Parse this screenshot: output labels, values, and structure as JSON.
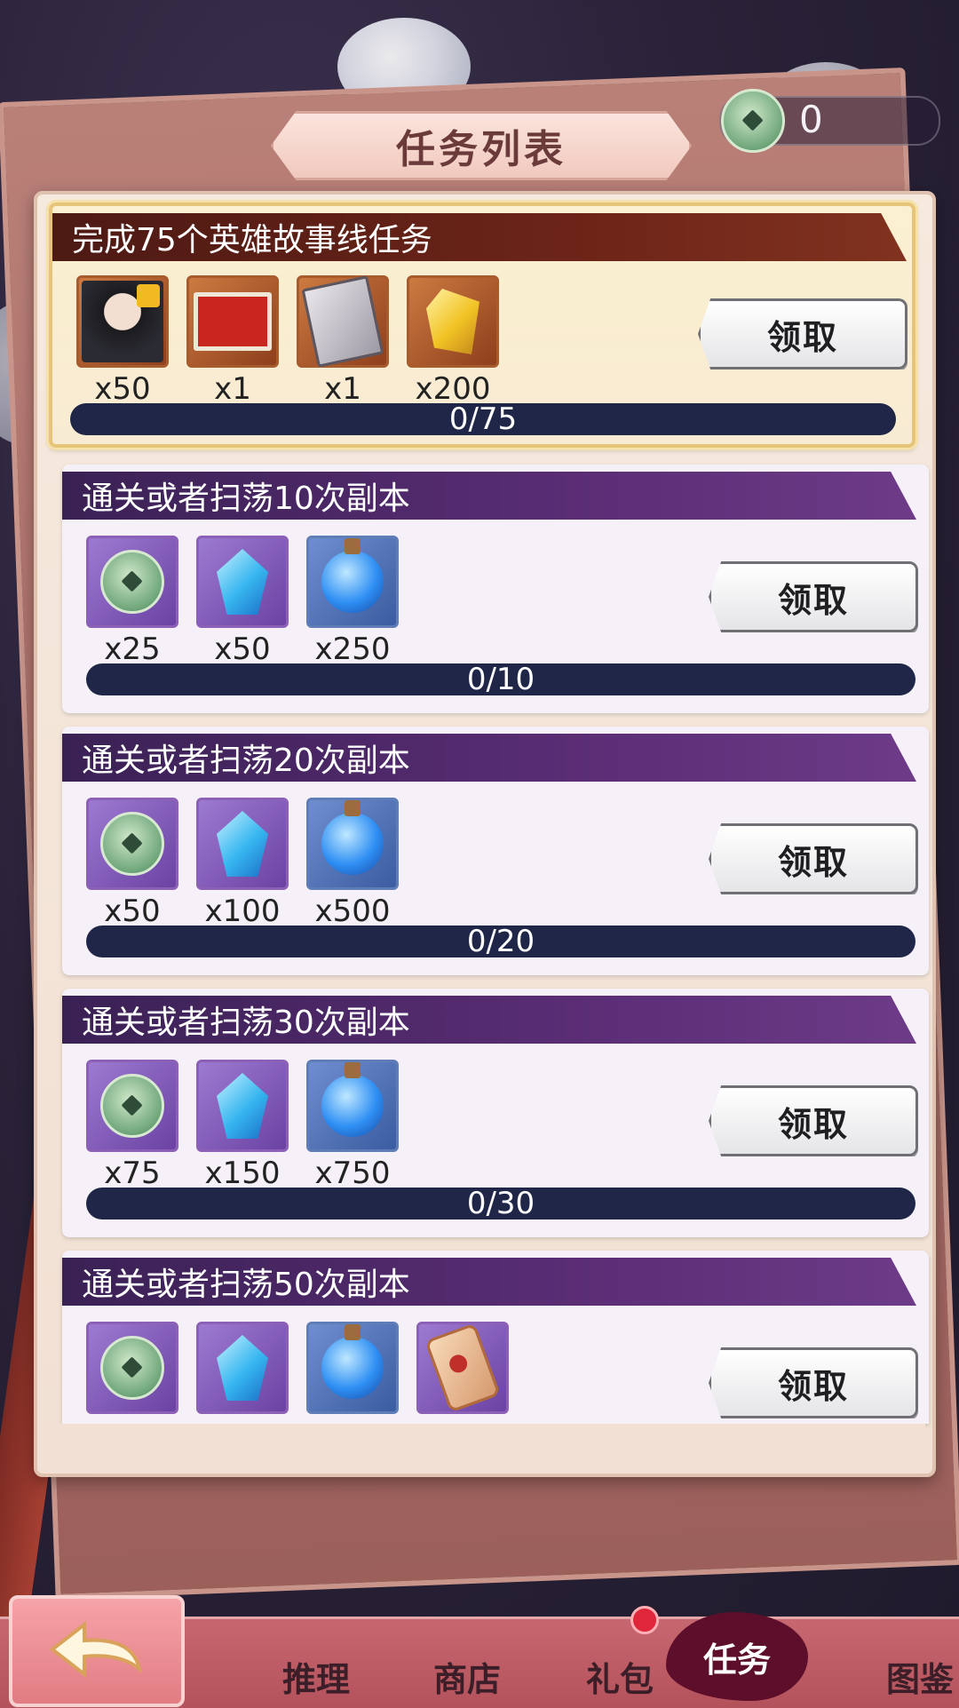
{
  "header": {
    "title": "任务列表"
  },
  "currency": {
    "value": "0"
  },
  "tasks": [
    {
      "title": "完成75个英雄故事线任务",
      "progress": "0/75",
      "button": "领取",
      "rewards": [
        {
          "icon": "hero-portrait-icon",
          "qty": "x50"
        },
        {
          "icon": "red-scroll-icon",
          "qty": "x1"
        },
        {
          "icon": "card-pack-icon",
          "qty": "x1"
        },
        {
          "icon": "topaz-crystal-icon",
          "qty": "x200"
        }
      ]
    },
    {
      "title": "通关或者扫荡10次副本",
      "progress": "0/10",
      "button": "领取",
      "rewards": [
        {
          "icon": "jade-coin-icon",
          "qty": "x25"
        },
        {
          "icon": "blue-gem-icon",
          "qty": "x50"
        },
        {
          "icon": "blue-potion-icon",
          "qty": "x250"
        }
      ]
    },
    {
      "title": "通关或者扫荡20次副本",
      "progress": "0/20",
      "button": "领取",
      "rewards": [
        {
          "icon": "jade-coin-icon",
          "qty": "x50"
        },
        {
          "icon": "blue-gem-icon",
          "qty": "x100"
        },
        {
          "icon": "blue-potion-icon",
          "qty": "x500"
        }
      ]
    },
    {
      "title": "通关或者扫荡30次副本",
      "progress": "0/30",
      "button": "领取",
      "rewards": [
        {
          "icon": "jade-coin-icon",
          "qty": "x75"
        },
        {
          "icon": "blue-gem-icon",
          "qty": "x150"
        },
        {
          "icon": "blue-potion-icon",
          "qty": "x750"
        }
      ]
    },
    {
      "title": "通关或者扫荡50次副本",
      "button": "领取",
      "rewards": [
        {
          "icon": "jade-coin-icon"
        },
        {
          "icon": "blue-gem-icon"
        },
        {
          "icon": "blue-potion-icon"
        },
        {
          "icon": "amulet-icon"
        }
      ]
    }
  ],
  "nav": {
    "tab1": "推理",
    "tab2": "商店",
    "tab3": "礼包",
    "tab4": "任务",
    "tab5": "图鉴",
    "active": "任务"
  },
  "colors": {
    "progress_bar": "#202648",
    "header_purple": "#5a2d75",
    "header_red": "#6c2418",
    "gold_border": "#e6c57b"
  }
}
